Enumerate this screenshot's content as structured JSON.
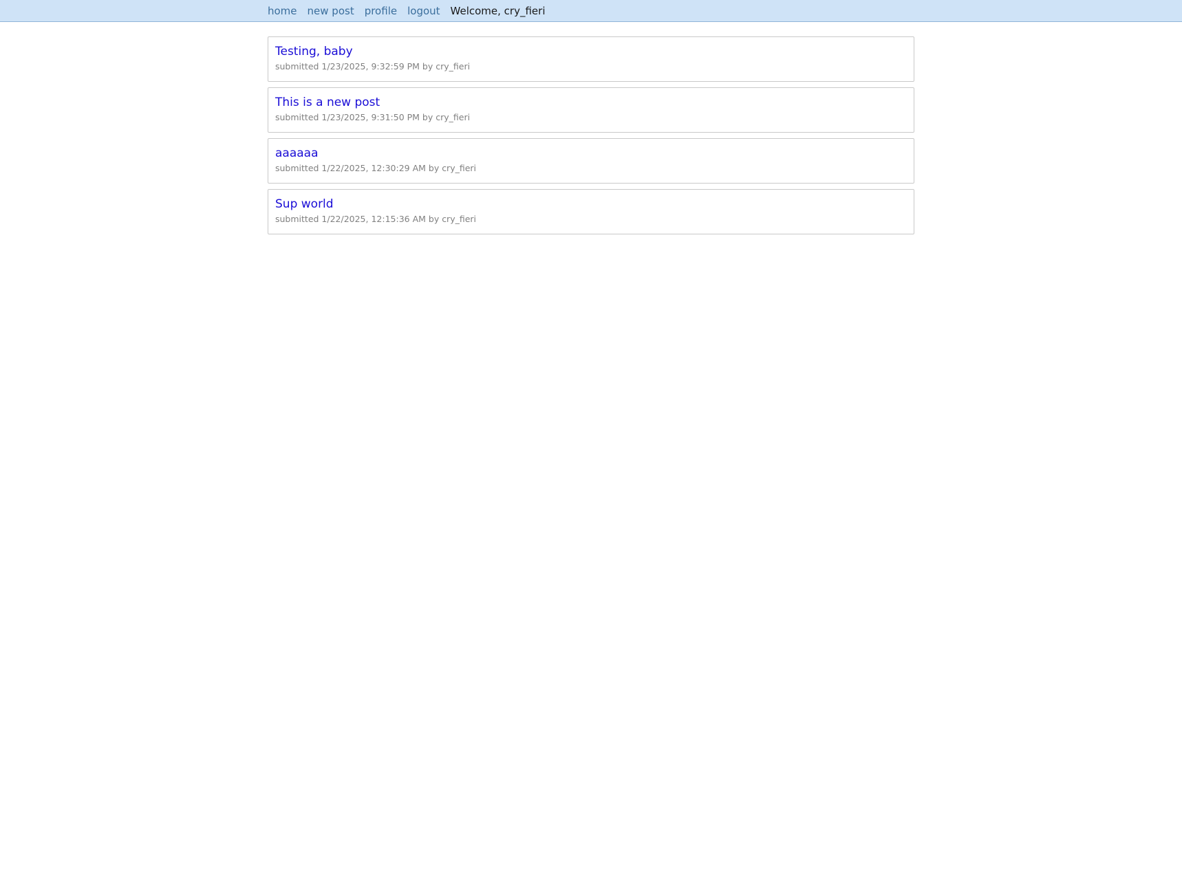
{
  "nav": {
    "home": "home",
    "new_post": "new post",
    "profile": "profile",
    "logout": "logout",
    "welcome": "Welcome, cry_fieri"
  },
  "posts": [
    {
      "title": "Testing, baby",
      "meta": "submitted 1/23/2025, 9:32:59 PM by cry_fieri"
    },
    {
      "title": "This is a new post",
      "meta": "submitted 1/23/2025, 9:31:50 PM by cry_fieri"
    },
    {
      "title": "aaaaaa",
      "meta": "submitted 1/22/2025, 12:30:29 AM by cry_fieri"
    },
    {
      "title": "Sup world",
      "meta": "submitted 1/22/2025, 12:15:36 AM by cry_fieri"
    }
  ],
  "colors": {
    "topbar_bg": "#cfe3f7",
    "nav_link": "#3b6e9c",
    "post_title_link": "#1a0dd6",
    "meta_text": "#808080"
  }
}
